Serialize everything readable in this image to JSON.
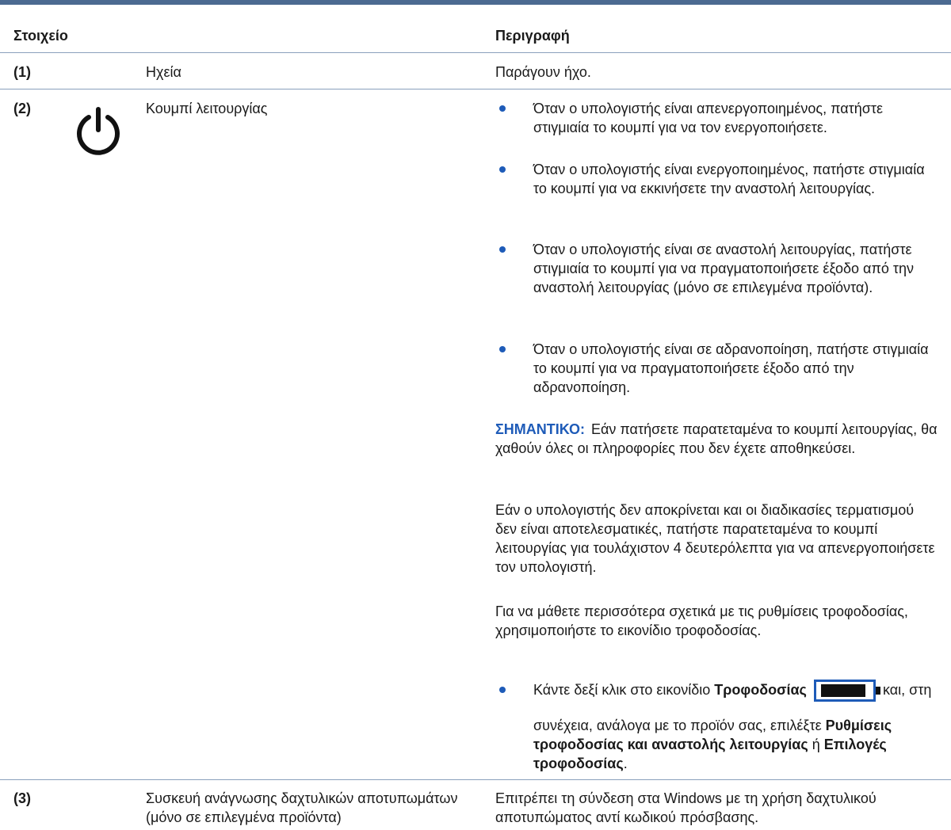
{
  "header": {
    "col_item": "Στοιχείο",
    "col_desc": "Περιγραφή"
  },
  "rows": [
    {
      "num": "(1)",
      "name": "Ηχεία",
      "desc": "Παράγουν ήχο."
    },
    {
      "num": "(2)",
      "icon": "power-icon",
      "name": "Κουμπί λειτουργίας",
      "bullets": [
        "Όταν ο υπολογιστής είναι απενεργοποιημένος, πατήστε στιγμιαία το κουμπί για να τον ενεργοποιήσετε.",
        "Όταν ο υπολογιστής είναι ενεργοποιημένος, πατήστε στιγμιαία το κουμπί για να εκκινήσετε την αναστολή λειτουργίας.",
        "Όταν ο υπολογιστής είναι σε αναστολή λειτουργίας, πατήστε στιγμιαία το κουμπί για να πραγματοποιήσετε έξοδο από την αναστολή λειτουργίας (μόνο σε επιλεγμένα προϊόντα).",
        "Όταν ο υπολογιστής είναι σε αδρανοποίηση, πατήστε στιγμιαία το κουμπί για να πραγματοποιήσετε έξοδο από την αδρανοποίηση."
      ],
      "important_label": "ΣΗΜΑΝΤΙΚΟ:",
      "important_text": "Εάν πατήσετε παρατεταμένα το κουμπί λειτουργίας, θα χαθούν όλες οι πληροφορίες που δεν έχετε αποθηκεύσει.",
      "para1": "Εάν ο υπολογιστής δεν αποκρίνεται και οι διαδικασίες τερματισμού δεν είναι αποτελεσματικές, πατήστε παρατεταμένα το κουμπί λειτουργίας για τουλάχιστον 4 δευτερόλεπτα για να απενεργοποιήσετε τον υπολογιστή.",
      "para2": "Για να μάθετε περισσότερα σχετικά με τις ρυθμίσεις τροφοδοσίας, χρησιμοποιήστε το εικονίδιο τροφοδοσίας.",
      "last_bullet": {
        "pre": "Κάντε δεξί κλικ στο εικονίδιο ",
        "power_word": "Τροφοδοσίας",
        "icon": "battery-icon",
        "post": " και, στη",
        "cont_pre": "συνέχεια, ανάλογα με το προϊόν σας, επιλέξτε ",
        "opt1": "Ρυθμίσεις τροφοδοσίας και αναστολής λειτουργίας",
        "or": " ή ",
        "opt2": "Επιλογές τροφοδοσίας",
        "end": "."
      }
    },
    {
      "num": "(3)",
      "name": "Συσκευή ανάγνωσης δαχτυλικών αποτυπωμάτων (μόνο σε επιλεγμένα προϊόντα)",
      "desc": "Επιτρέπει τη σύνδεση στα Windows με τη χρήση δαχτυλικού αποτυπώματος αντί κωδικού πρόσβασης."
    }
  ],
  "colors": {
    "accent": "#1e5bb8",
    "rule": "#4c6a91"
  }
}
